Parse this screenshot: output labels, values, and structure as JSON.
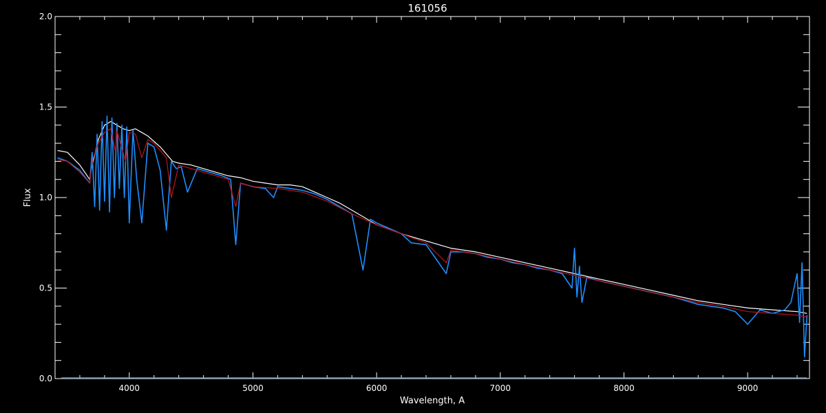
{
  "colors": {
    "background": "#000000",
    "axes": "#ffffff",
    "observed_white": "#ffffff",
    "observed_blue": "#1e8fff",
    "model_red": "#c0141e"
  },
  "chart_data": {
    "type": "line",
    "title": "161056",
    "xlabel": "Wavelength, A",
    "ylabel": "Flux",
    "xlim": [
      3400,
      9500
    ],
    "ylim": [
      0.0,
      2.0
    ],
    "xticks": [
      4000,
      5000,
      6000,
      7000,
      8000,
      9000
    ],
    "xtick_labels": [
      "4000",
      "5000",
      "6000",
      "7000",
      "8000",
      "9000"
    ],
    "yticks": [
      0.0,
      0.5,
      1.0,
      1.5,
      2.0
    ],
    "ytick_labels": [
      "0.0",
      "0.5",
      "1.0",
      "1.5",
      "2.0"
    ],
    "grid": false,
    "series": [
      {
        "color": "#ffffff",
        "x": [
          3420,
          3500,
          3600,
          3680,
          3700,
          3750,
          3800,
          3850,
          3900,
          3950,
          4000,
          4050,
          4100,
          4150,
          4200,
          4250,
          4300,
          4350,
          4400,
          4500,
          4600,
          4700,
          4800,
          4900,
          5000,
          5100,
          5200,
          5300,
          5400,
          5500,
          5600,
          5700,
          5800,
          5900,
          6000,
          6200,
          6400,
          6600,
          6800,
          7000,
          7200,
          7400,
          7600,
          7800,
          8000,
          8200,
          8400,
          8600,
          8800,
          9000,
          9200,
          9400,
          9480
        ],
        "y": [
          1.26,
          1.25,
          1.18,
          1.1,
          1.18,
          1.32,
          1.4,
          1.42,
          1.4,
          1.38,
          1.37,
          1.38,
          1.36,
          1.34,
          1.31,
          1.28,
          1.24,
          1.2,
          1.19,
          1.18,
          1.16,
          1.14,
          1.12,
          1.11,
          1.09,
          1.08,
          1.07,
          1.07,
          1.06,
          1.03,
          1.0,
          0.97,
          0.93,
          0.89,
          0.85,
          0.8,
          0.76,
          0.72,
          0.7,
          0.67,
          0.64,
          0.61,
          0.58,
          0.55,
          0.52,
          0.49,
          0.46,
          0.43,
          0.41,
          0.39,
          0.38,
          0.37,
          0.36
        ]
      },
      {
        "color": "#1e8fff",
        "x": [
          3420,
          3500,
          3600,
          3680,
          3700,
          3720,
          3740,
          3760,
          3780,
          3800,
          3820,
          3840,
          3860,
          3880,
          3900,
          3920,
          3940,
          3960,
          3980,
          4000,
          4030,
          4060,
          4101,
          4150,
          4200,
          4250,
          4300,
          4340,
          4380,
          4420,
          4471,
          4550,
          4650,
          4750,
          4820,
          4861,
          4900,
          4950,
          5000,
          5100,
          5167,
          5200,
          5300,
          5400,
          5500,
          5600,
          5700,
          5800,
          5890,
          5950,
          6000,
          6200,
          6280,
          6400,
          6563,
          6600,
          6700,
          6800,
          6900,
          7000,
          7100,
          7200,
          7300,
          7400,
          7500,
          7580,
          7600,
          7620,
          7640,
          7660,
          7700,
          7800,
          8000,
          8200,
          8400,
          8500,
          8600,
          8700,
          8800,
          8900,
          9000,
          9100,
          9200,
          9300,
          9350,
          9400,
          9420,
          9440,
          9460,
          9480
        ],
        "y": [
          1.22,
          1.2,
          1.15,
          1.08,
          1.25,
          0.95,
          1.35,
          0.93,
          1.42,
          0.98,
          1.45,
          0.92,
          1.44,
          1.0,
          1.41,
          1.05,
          1.4,
          1.0,
          1.39,
          0.86,
          1.37,
          1.1,
          0.86,
          1.3,
          1.28,
          1.15,
          0.82,
          1.2,
          1.16,
          1.17,
          1.03,
          1.16,
          1.14,
          1.12,
          1.1,
          0.74,
          1.08,
          1.07,
          1.06,
          1.05,
          1.0,
          1.06,
          1.05,
          1.04,
          1.02,
          0.99,
          0.95,
          0.91,
          0.6,
          0.88,
          0.86,
          0.8,
          0.75,
          0.74,
          0.58,
          0.7,
          0.7,
          0.69,
          0.67,
          0.66,
          0.64,
          0.63,
          0.61,
          0.6,
          0.58,
          0.5,
          0.72,
          0.45,
          0.62,
          0.42,
          0.56,
          0.54,
          0.51,
          0.48,
          0.45,
          0.43,
          0.41,
          0.4,
          0.39,
          0.37,
          0.3,
          0.38,
          0.36,
          0.38,
          0.42,
          0.58,
          0.31,
          0.64,
          0.12,
          0.35
        ]
      },
      {
        "color": "#c0141e",
        "x": [
          3420,
          3500,
          3600,
          3680,
          3700,
          3750,
          3800,
          3850,
          3889,
          3900,
          3970,
          4000,
          4050,
          4101,
          4150,
          4200,
          4250,
          4300,
          4340,
          4400,
          4500,
          4600,
          4700,
          4800,
          4861,
          4900,
          5000,
          5200,
          5400,
          5600,
          5800,
          6000,
          6200,
          6400,
          6563,
          6600,
          6800,
          7000,
          7200,
          7400,
          7600,
          7800,
          8000,
          8200,
          8400,
          8600,
          8800,
          9000,
          9200,
          9400,
          9480
        ],
        "y": [
          1.21,
          1.2,
          1.14,
          1.08,
          1.2,
          1.3,
          1.36,
          1.38,
          1.25,
          1.37,
          1.2,
          1.36,
          1.35,
          1.22,
          1.32,
          1.3,
          1.26,
          1.22,
          1.0,
          1.18,
          1.16,
          1.14,
          1.12,
          1.1,
          0.95,
          1.08,
          1.06,
          1.05,
          1.03,
          0.98,
          0.91,
          0.85,
          0.8,
          0.75,
          0.64,
          0.71,
          0.69,
          0.66,
          0.63,
          0.6,
          0.57,
          0.54,
          0.51,
          0.48,
          0.45,
          0.42,
          0.4,
          0.37,
          0.36,
          0.35,
          0.34
        ]
      }
    ]
  }
}
